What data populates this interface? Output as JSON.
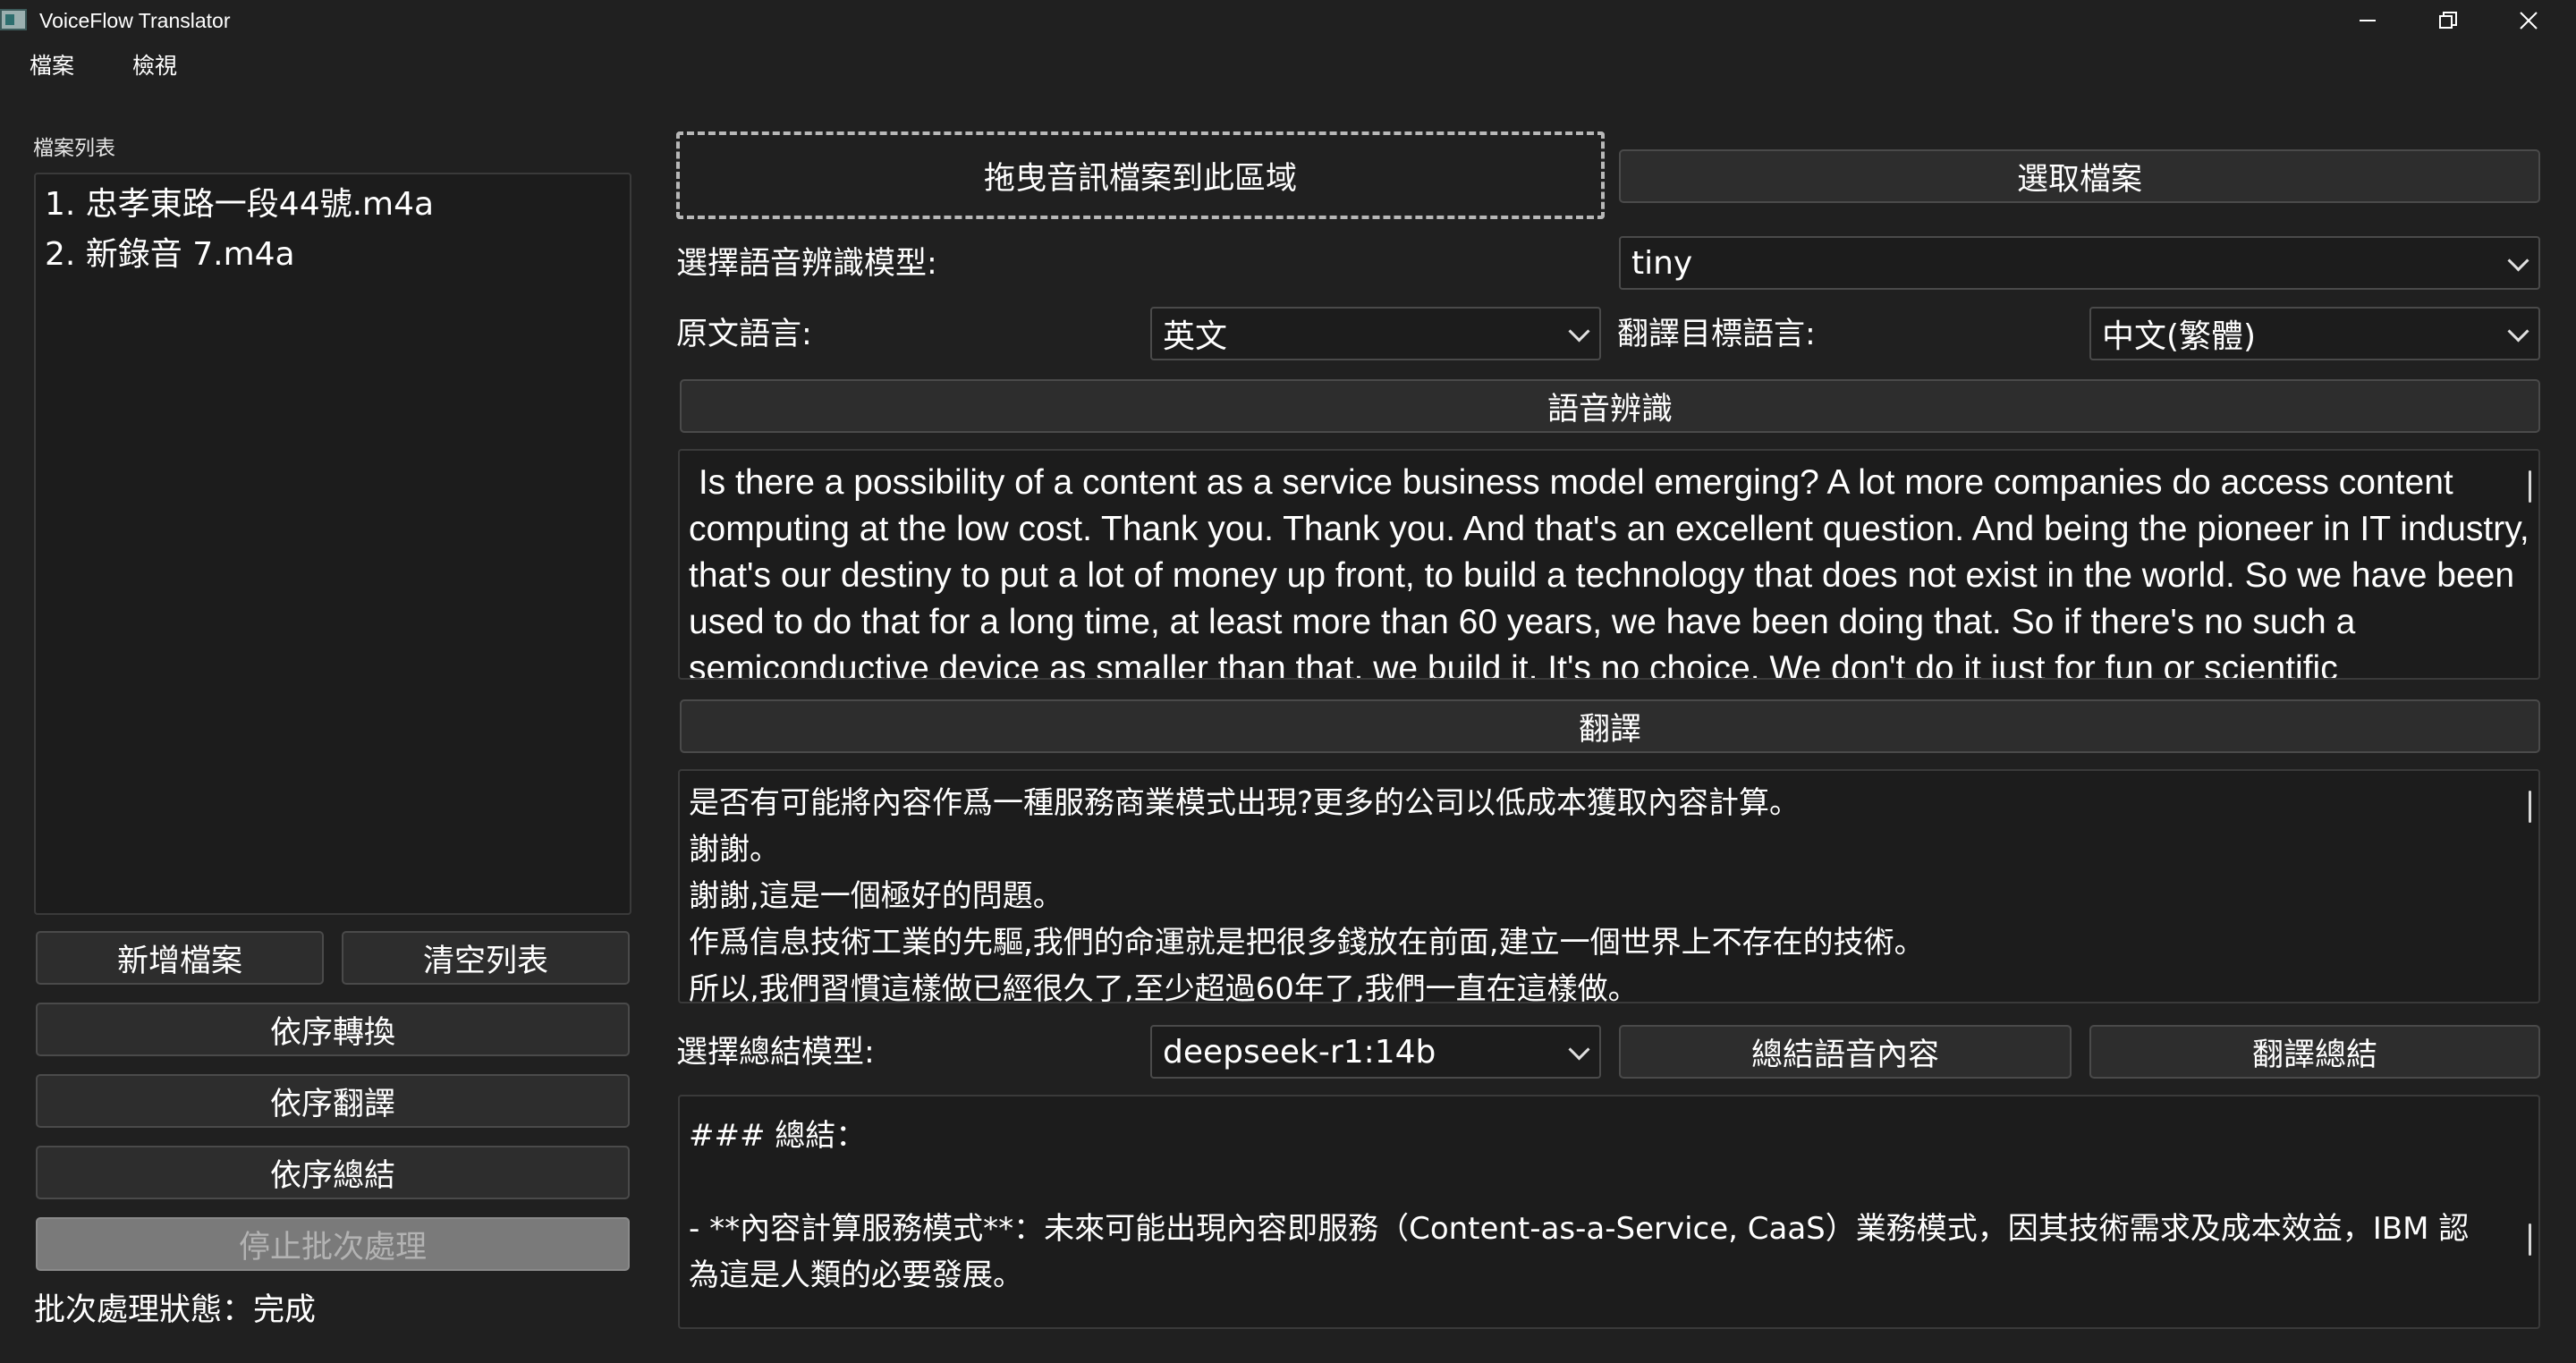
{
  "window": {
    "title": "VoiceFlow Translator",
    "minimize_glyph": "—",
    "maximize_glyph": "❐",
    "close_glyph": "✕"
  },
  "menu": [
    "檔案",
    "檢視"
  ],
  "left": {
    "file_list_label": "檔案列表",
    "files": [
      "1. 忠孝東路一段44號.m4a",
      "2. 新錄音 7.m4a"
    ],
    "add_file": "新增檔案",
    "clear_list": "清空列表",
    "batch_convert": "依序轉換",
    "batch_translate": "依序翻譯",
    "batch_summarize": "依序總結",
    "stop_batch": "停止批次處理",
    "status": "批次處理狀態：完成"
  },
  "right": {
    "drop_zone": "拖曳音訊檔案到此區域",
    "select_file": "選取檔案",
    "model_label": "選擇語音辨識模型:",
    "model_value": "tiny",
    "source_lang_label": "原文語言:",
    "source_lang_value": "英文",
    "target_lang_label": "翻譯目標語言:",
    "target_lang_value": "中文(繁體)",
    "recognize_button": "語音辨識",
    "recognize_text": " Is there a possibility of a content as a service business model emerging? A lot more companies do access content computing at the low cost. Thank you. Thank you. And that's an excellent question. And being the pioneer in IT industry, that's our destiny to put a lot of money up front, to build a technology that does not exist in the world. So we have been used to do that for a long time, at least more than 60 years, we have been doing that. So if there's no such a semiconductive device as smaller than that, we build it. It's no choice. We don't do it just for fun or scientific",
    "translate_button": "翻譯",
    "translate_lines": [
      "是否有可能將內容作爲一種服務商業模式出現?更多的公司以低成本獲取內容計算。",
      "謝謝。",
      "謝謝,這是一個極好的問題。",
      "作爲信息技術工業的先驅,我們的命運就是把很多錢放在前面,建立一個世界上不存在的技術。",
      "所以,我們習慣這樣做已經很久了,至少超過60年了,我們一直在這樣做。"
    ],
    "summary_model_label": "選擇總結模型:",
    "summary_model_value": "deepseek-r1:14b",
    "summarize_button": "總結語音內容",
    "translate_summary_button": "翻譯總結",
    "summary_lines": [
      "### 總結：",
      "",
      "- **內容計算服務模式**：未來可能出現內容即服務（Content-as-a-Service, CaaS）業務模式，因其技術需求及成本效益，IBM 認為這是人類的必要發展。"
    ]
  }
}
